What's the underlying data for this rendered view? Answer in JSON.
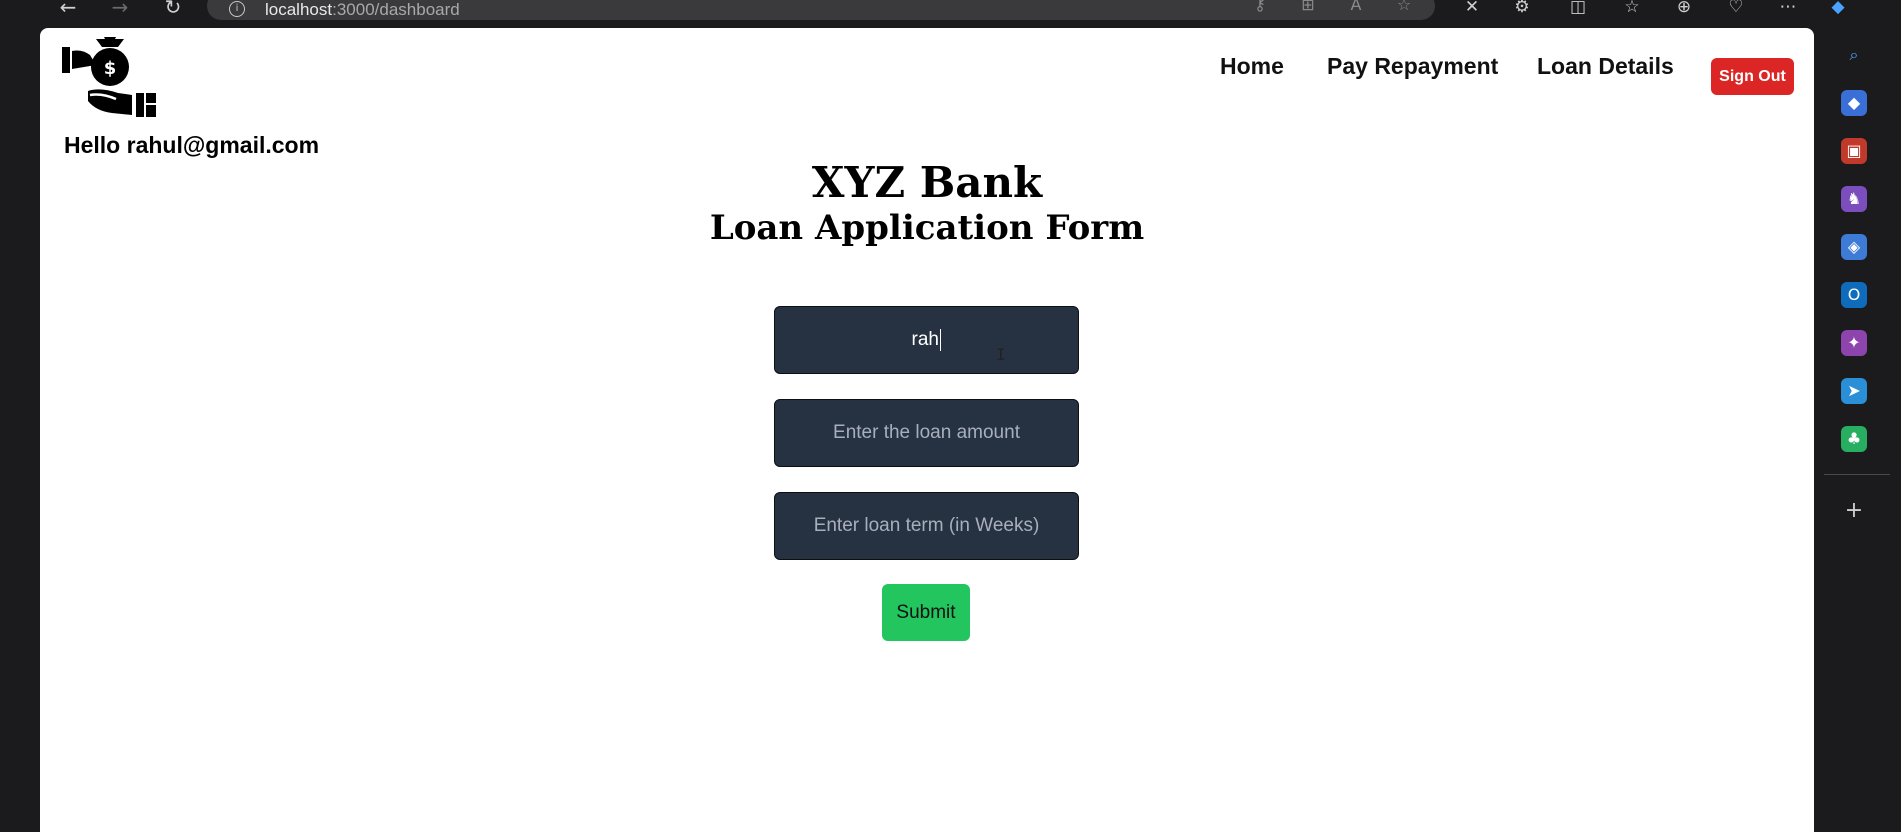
{
  "browser": {
    "url_host": "localhost",
    "url_path": ":3000/dashboard",
    "back_icon": "arrow-left-icon",
    "forward_icon": "arrow-right-icon",
    "reload_icon": "reload-icon"
  },
  "header": {
    "greeting": "Hello rahul@gmail.com",
    "nav": {
      "home": "Home",
      "pay_repayment": "Pay Repayment",
      "loan_details": "Loan Details"
    },
    "signout_label": "Sign Out",
    "signout_color": "#dc2626"
  },
  "main": {
    "title": "XYZ Bank",
    "subtitle": "Loan Application Form",
    "name_value": "rah",
    "amount_placeholder": "Enter the loan amount",
    "term_placeholder": "Enter loan term (in Weeks)",
    "submit_label": "Submit",
    "submit_color": "#22c55e",
    "field_color": "#263142"
  },
  "sidebar": {
    "icons": [
      "search-icon",
      "tag-icon",
      "briefcase-icon",
      "chess-icon",
      "copilot-icon",
      "outlook-icon",
      "puzzle-icon",
      "send-icon",
      "tree-icon",
      "add-icon"
    ]
  }
}
